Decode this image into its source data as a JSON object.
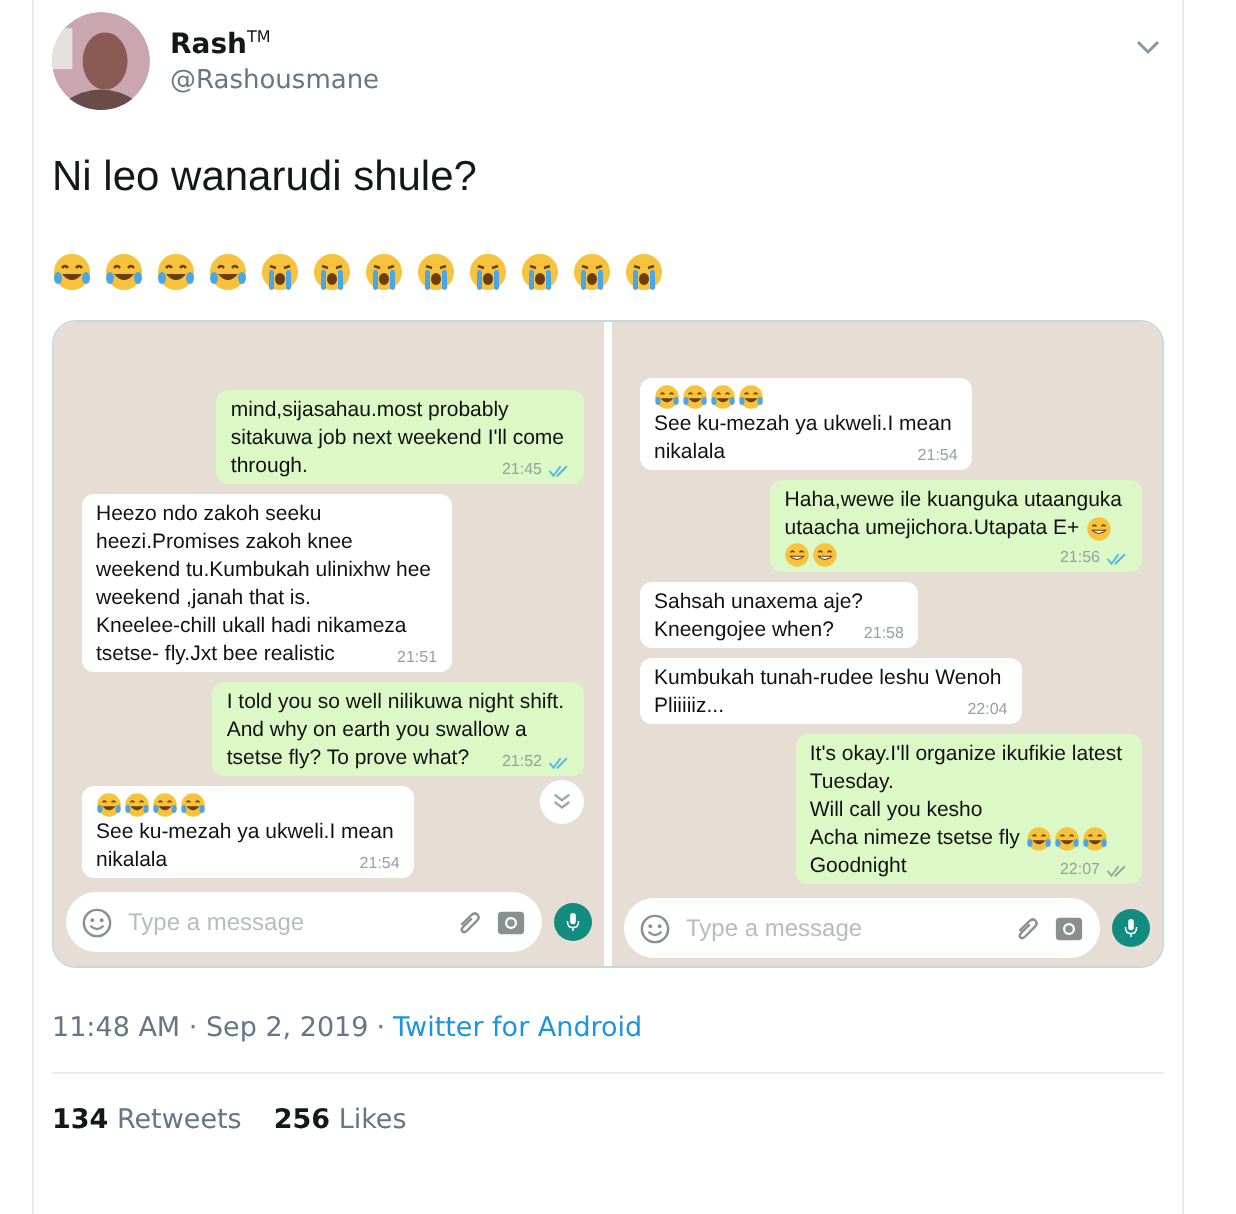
{
  "author": {
    "name": "Rash$^{TM}$",
    "handle": "@Rashousmane"
  },
  "tweet": {
    "text": "Ni leo wanarudi shule?",
    "emojis": [
      {
        "kind": "joy"
      },
      {
        "kind": "joy"
      },
      {
        "kind": "joy"
      },
      {
        "kind": "joy"
      },
      {
        "kind": "sob"
      },
      {
        "kind": "sob"
      },
      {
        "kind": "sob"
      },
      {
        "kind": "sob"
      },
      {
        "kind": "sob"
      },
      {
        "kind": "sob"
      },
      {
        "kind": "sob"
      },
      {
        "kind": "sob"
      }
    ]
  },
  "chats": [
    {
      "messages": [
        {
          "outgoing": true,
          "lines": [
            {
              "text": "mind,sijasahau.most probably"
            },
            {
              "text": "sitakuwa job next weekend I'll come"
            },
            {
              "text": "through."
            }
          ],
          "time": "21:45",
          "read": true
        },
        {
          "outgoing": false,
          "lines": [
            {
              "text": "Heezo ndo zakoh seeku"
            },
            {
              "text": "heezi.Promises zakoh knee"
            },
            {
              "text": "weekend  tu.Kumbukah ulinixhw hee"
            },
            {
              "text": "weekend ,janah that is."
            },
            {
              "text": "Kneelee-chill ukall hadi nikameza"
            },
            {
              "text": "tsetse- fly.Jxt bee realistic"
            }
          ],
          "time": "21:51"
        },
        {
          "outgoing": true,
          "lines": [
            {
              "text": "I told you so well nilikuwa night shift."
            },
            {
              "text": "And why on earth you swallow a"
            },
            {
              "text": "tsetse fly? To prove what?"
            }
          ],
          "time": "21:52",
          "read": true
        },
        {
          "outgoing": false,
          "lines": [
            {
              "emojis": [
                {
                  "kind": "joy"
                },
                {
                  "kind": "joy"
                },
                {
                  "kind": "joy"
                },
                {
                  "kind": "joy"
                }
              ]
            },
            {
              "text": "See ku-mezah ya ukweli.I mean"
            },
            {
              "text": "nikalala"
            }
          ],
          "time": "21:54"
        }
      ],
      "scroll_button": true,
      "input": {
        "placeholder": "Type a message"
      }
    },
    {
      "messages": [
        {
          "outgoing": false,
          "lines": [
            {
              "emojis": [
                {
                  "kind": "joy"
                },
                {
                  "kind": "joy"
                },
                {
                  "kind": "joy"
                },
                {
                  "kind": "joy"
                }
              ]
            },
            {
              "text": "See ku-mezah ya ukweli.I mean"
            },
            {
              "text": "nikalala"
            }
          ],
          "time": "21:54"
        },
        {
          "outgoing": true,
          "lines": [
            {
              "text": "Haha,wewe ile kuanguka utaanguka"
            },
            {
              "text": "utaacha umejichora.Utapata E+",
              "emojis": [
                {
                  "kind": "grin"
                }
              ]
            },
            {
              "emojis": [
                {
                  "kind": "grin"
                },
                {
                  "kind": "grin"
                }
              ]
            }
          ],
          "time": "21:56",
          "read": true
        },
        {
          "outgoing": false,
          "lines": [
            {
              "text": "Sahsah unaxema aje?"
            },
            {
              "text": "Kneengojee when?"
            }
          ],
          "time": "21:58"
        },
        {
          "outgoing": false,
          "lines": [
            {
              "text": "Kumbukah tunah-rudee leshu Wenoh"
            },
            {
              "text": "Pliiiiiz..."
            }
          ],
          "time": "22:04"
        },
        {
          "outgoing": true,
          "lines": [
            {
              "text": "It's okay.I'll organize ikufikie latest"
            },
            {
              "text": "Tuesday."
            },
            {
              "text": "Will call you kesho"
            },
            {
              "text": "Acha nimeze tsetse fly",
              "emojis": [
                {
                  "kind": "joy"
                },
                {
                  "kind": "joy"
                },
                {
                  "kind": "joy"
                }
              ]
            },
            {
              "text": "Goodnight"
            }
          ],
          "time": "22:07",
          "read": false
        }
      ],
      "scroll_button": false,
      "input": {
        "placeholder": "Type a message"
      }
    }
  ],
  "footer": {
    "timestamp": "11:48 AM · Sep 2, 2019",
    "separator": "·",
    "source": "Twitter for Android"
  },
  "stats": [
    {
      "count": "134",
      "label": "Retweets"
    },
    {
      "count": "256",
      "label": "Likes"
    }
  ]
}
